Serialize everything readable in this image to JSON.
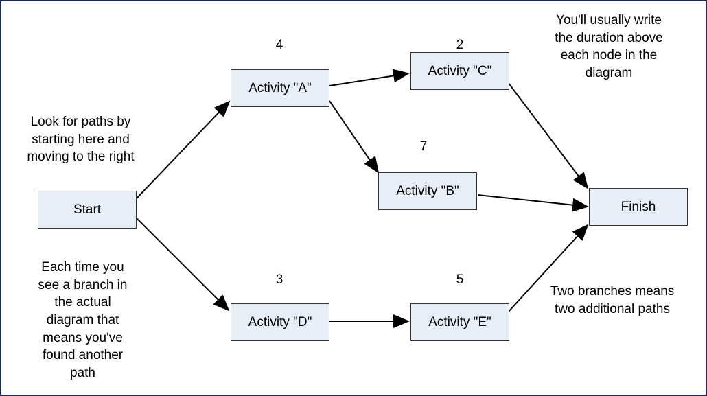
{
  "nodes": {
    "start": "Start",
    "a": "Activity \"A\"",
    "b": "Activity \"B\"",
    "c": "Activity \"C\"",
    "d": "Activity \"D\"",
    "e": "Activity \"E\"",
    "finish": "Finish"
  },
  "durations": {
    "a": "4",
    "b": "7",
    "c": "2",
    "d": "3",
    "e": "5"
  },
  "annotations": {
    "top_left": "Look for paths by\nstarting here and\nmoving to the right",
    "top_right": "You'll usually write\nthe duration above\neach node in the\ndiagram",
    "bottom_left": "Each time you\nsee a branch in\nthe actual\ndiagram that\nmeans you've\nfound another\npath",
    "bottom_right": "Two branches means\ntwo additional paths"
  }
}
